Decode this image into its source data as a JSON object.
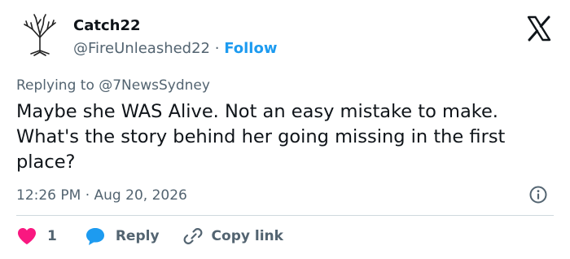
{
  "author": {
    "display_name": "Catch22",
    "handle": "@FireUnleashed22",
    "separator": "·",
    "follow_label": "Follow",
    "avatar_icon": "tree-avatar-icon"
  },
  "platform": {
    "logo_icon": "x-logo-icon"
  },
  "tweet": {
    "reply_to": "Replying to @7NewsSydney",
    "text": "Maybe she WAS Alive. Not an easy mistake to make. What's the story behind her going missing in the first place?",
    "timestamp": "12:26 PM · Aug 20, 2026"
  },
  "actions": {
    "like_count": "1",
    "reply_label": "Reply",
    "copy_link_label": "Copy link"
  },
  "colors": {
    "text": "#0f1419",
    "muted": "#536471",
    "accent_blue": "#1d9bf0",
    "like_red": "#f91880",
    "divider": "#cfd9de"
  }
}
